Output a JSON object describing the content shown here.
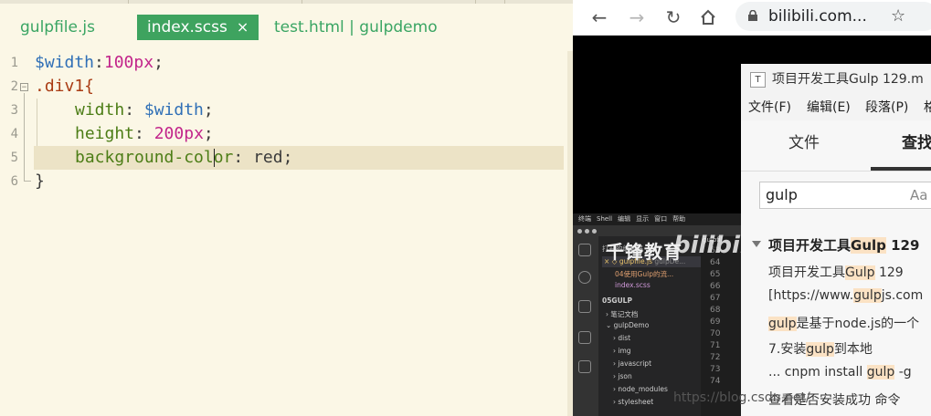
{
  "editor": {
    "tabs": [
      {
        "label": "gulpfile.js"
      },
      {
        "label": "index.scss",
        "close": "×"
      },
      {
        "label": "test.html | gulpdemo"
      }
    ],
    "line_numbers": [
      "1",
      "2",
      "3",
      "4",
      "5",
      "6"
    ],
    "code": {
      "l1_var": "$width",
      "l1_colon": ":",
      "l1_num": "100px",
      "l1_semi": ";",
      "l2_sel": ".div1{",
      "l3_prop": "width",
      "l3_colon": ": ",
      "l3_val": "$width",
      "l3_semi": ";",
      "l4_prop": "height",
      "l4_colon": ": ",
      "l4_val": "200px",
      "l4_semi": ";",
      "l5_prop_a": "background-col",
      "l5_prop_b": "or",
      "l5_colon": ": ",
      "l5_val": "red",
      "l5_semi": ";",
      "l6_close": "}"
    }
  },
  "browser": {
    "url": "bilibili.com...",
    "colors": {
      "accent_tab": "#3ea35f"
    },
    "typora": {
      "icon_letter": "T",
      "title": "项目开发工具Gulp 129.m",
      "menu": [
        "文件(F)",
        "编辑(E)",
        "段落(P)",
        "格"
      ],
      "tabs": [
        "文件",
        "查找"
      ],
      "search_value": "gulp",
      "search_option": "Aa",
      "results": {
        "head_a": "项目开发工具",
        "head_hl": "Gulp",
        "head_b": " 129",
        "r1_a": "项目开发工具",
        "r1_hl": "Gulp",
        "r1_b": " 129",
        "r2_a": "[https://www.",
        "r2_hl": "gulp",
        "r2_b": "js.com",
        "r3_hl": "gulp",
        "r3_b": "是基于node.js的一个",
        "r4_a": "7.安装",
        "r4_hl": "gulp",
        "r4_b": "到本地",
        "r5_a": "...   cnpm  install ",
        "r5_hl": "gulp",
        "r5_b": "  -g",
        "r6": "查看是否安装成功  命令"
      }
    },
    "vscode": {
      "mac_menu": [
        "终端",
        "Shell",
        "编辑",
        "显示",
        "窗口",
        "帮助"
      ],
      "open_editors": "打开的编辑器",
      "files": [
        "gulpfile.js",
        "04使用Gulp的流...",
        "index.scss"
      ],
      "file_dir": "gulpDe...",
      "workspace": "05GULP",
      "folders": [
        "笔记文档",
        "gulpDemo",
        "dist",
        "img",
        "javascript",
        "json",
        "node_modules",
        "stylesheet"
      ],
      "lines": [
        "63",
        "64",
        "65",
        "66",
        "67",
        "68",
        "69",
        "70",
        "71",
        "72",
        "73",
        "74"
      ],
      "watermark_a": "千锋教育",
      "watermark_b": "bilibili",
      "tab_text": "gulpfil"
    },
    "csdn_watermark": "https://blog.csdn.net/"
  }
}
